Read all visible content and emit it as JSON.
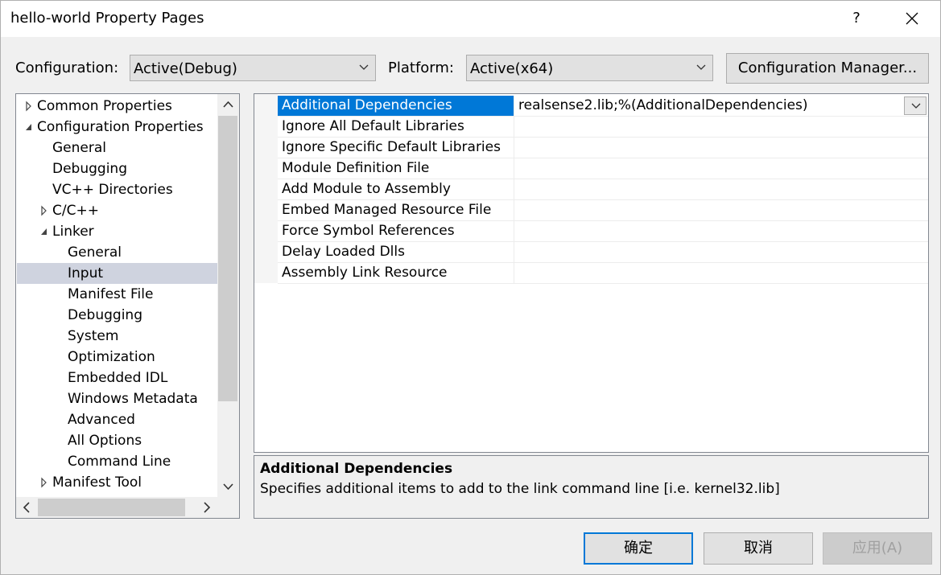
{
  "window": {
    "title": "hello-world Property Pages",
    "help": "?"
  },
  "config": {
    "label": "Configuration:",
    "value": "Active(Debug)"
  },
  "platform": {
    "label": "Platform:",
    "value": "Active(x64)"
  },
  "config_manager_label": "Configuration Manager...",
  "tree": {
    "items": [
      {
        "label": "Common Properties",
        "level": 0,
        "expander": "collapsed"
      },
      {
        "label": "Configuration Properties",
        "level": 0,
        "expander": "expanded"
      },
      {
        "label": "General",
        "level": 1,
        "expander": "none"
      },
      {
        "label": "Debugging",
        "level": 1,
        "expander": "none"
      },
      {
        "label": "VC++ Directories",
        "level": 1,
        "expander": "none"
      },
      {
        "label": "C/C++",
        "level": 1,
        "expander": "collapsed"
      },
      {
        "label": "Linker",
        "level": 1,
        "expander": "expanded"
      },
      {
        "label": "General",
        "level": 2,
        "expander": "none"
      },
      {
        "label": "Input",
        "level": 2,
        "expander": "none",
        "selected": true
      },
      {
        "label": "Manifest File",
        "level": 2,
        "expander": "none"
      },
      {
        "label": "Debugging",
        "level": 2,
        "expander": "none"
      },
      {
        "label": "System",
        "level": 2,
        "expander": "none"
      },
      {
        "label": "Optimization",
        "level": 2,
        "expander": "none"
      },
      {
        "label": "Embedded IDL",
        "level": 2,
        "expander": "none"
      },
      {
        "label": "Windows Metadata",
        "level": 2,
        "expander": "none"
      },
      {
        "label": "Advanced",
        "level": 2,
        "expander": "none"
      },
      {
        "label": "All Options",
        "level": 2,
        "expander": "none"
      },
      {
        "label": "Command Line",
        "level": 2,
        "expander": "none"
      },
      {
        "label": "Manifest Tool",
        "level": 1,
        "expander": "collapsed"
      }
    ]
  },
  "properties": [
    {
      "name": "Additional Dependencies",
      "value": "realsense2.lib;%(AdditionalDependencies)",
      "selected": true
    },
    {
      "name": "Ignore All Default Libraries",
      "value": ""
    },
    {
      "name": "Ignore Specific Default Libraries",
      "value": ""
    },
    {
      "name": "Module Definition File",
      "value": ""
    },
    {
      "name": "Add Module to Assembly",
      "value": ""
    },
    {
      "name": "Embed Managed Resource File",
      "value": ""
    },
    {
      "name": "Force Symbol References",
      "value": ""
    },
    {
      "name": "Delay Loaded Dlls",
      "value": ""
    },
    {
      "name": "Assembly Link Resource",
      "value": ""
    }
  ],
  "description": {
    "title": "Additional Dependencies",
    "text": "Specifies additional items to add to the link command line [i.e. kernel32.lib]"
  },
  "buttons": {
    "ok": "确定",
    "cancel": "取消",
    "apply": "应用(A)"
  },
  "colors": {
    "selection": "#0078d7",
    "tree_selection": "#cfd3df"
  }
}
